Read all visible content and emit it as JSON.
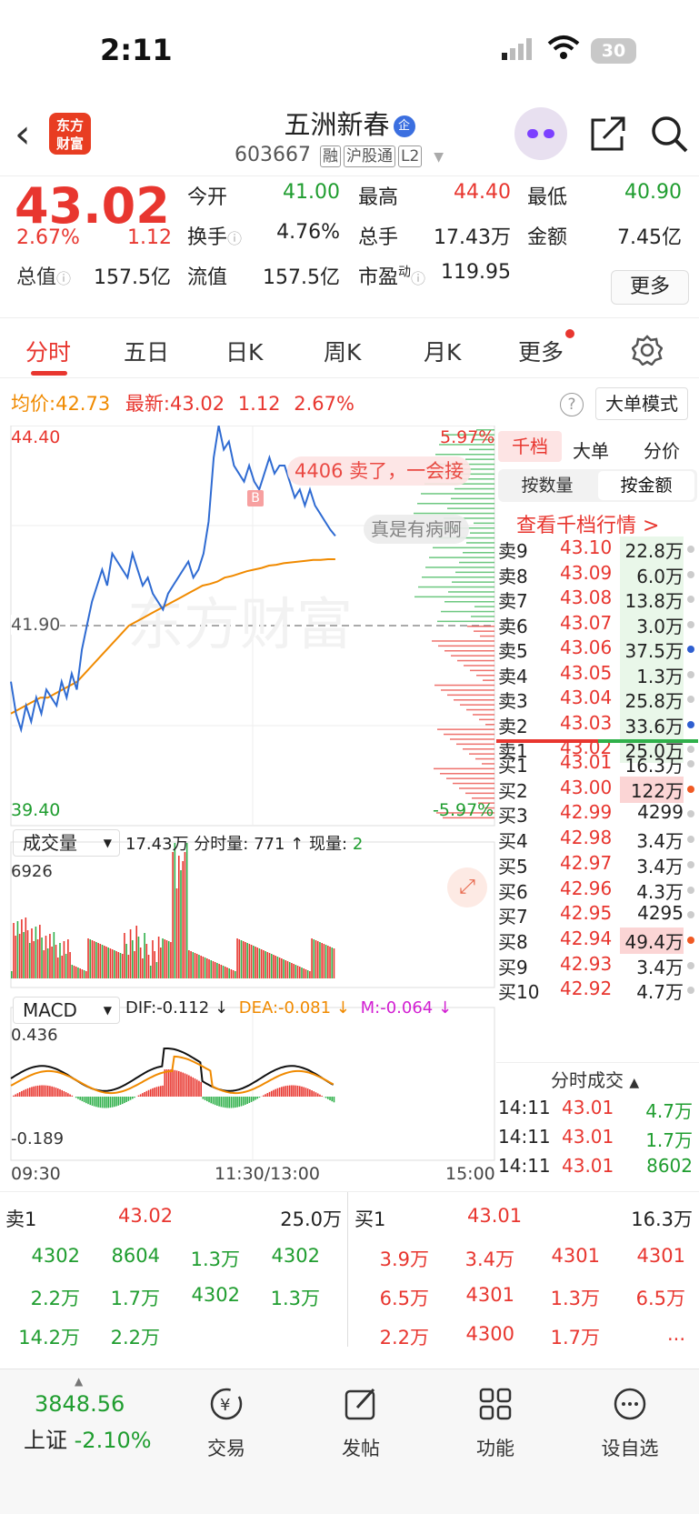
{
  "status_bar": {
    "time": "2:11",
    "battery": "30"
  },
  "header": {
    "logo_text_1": "东方",
    "logo_text_2": "财富",
    "stock_name": "五洲新春",
    "company_badge": "企",
    "code": "603667",
    "tags": [
      "融",
      "沪股通",
      "L2"
    ]
  },
  "quote": {
    "price": "43.02",
    "pct": "2.67%",
    "change": "1.12",
    "fields": [
      {
        "label": "今开",
        "value": "41.00",
        "color": "green"
      },
      {
        "label": "最高",
        "value": "44.40",
        "color": "red"
      },
      {
        "label": "最低",
        "value": "40.90",
        "color": "green"
      },
      {
        "label": "换手",
        "value": "4.76%",
        "color": "black"
      },
      {
        "label": "总手",
        "value": "17.43万",
        "color": "black"
      },
      {
        "label": "金额",
        "value": "7.45亿",
        "color": "black"
      },
      {
        "label": "总值",
        "value": "157.5亿",
        "color": "black"
      },
      {
        "label": "流值",
        "value": "157.5亿",
        "color": "black"
      },
      {
        "label": "市盈",
        "value": "119.95",
        "color": "black"
      }
    ],
    "pe_sup": "动",
    "more_label": "更多"
  },
  "tabs": [
    "分时",
    "五日",
    "日K",
    "周K",
    "月K",
    "更多"
  ],
  "avg_line": {
    "avg_label": "均价:",
    "avg": "42.73",
    "latest_label": "最新:",
    "latest": "43.02",
    "chg": "1.12",
    "pct": "2.67%"
  },
  "big_order_mode": "大单模式",
  "chart_data": {
    "type": "line",
    "price_axis": {
      "max": "44.40",
      "ref": "41.90",
      "min": "39.40",
      "max_pct": "5.97%",
      "min_pct": "-5.97%"
    },
    "time_labels": [
      "09:30",
      "11:30/13:00",
      "15:00"
    ],
    "price_series": [
      41.2,
      40.8,
      40.6,
      40.9,
      40.7,
      41.0,
      40.8,
      41.1,
      41.0,
      40.9,
      41.2,
      41.0,
      41.3,
      41.1,
      41.6,
      41.9,
      42.2,
      42.4,
      42.6,
      42.4,
      42.8,
      42.7,
      42.6,
      42.5,
      42.8,
      42.6,
      42.4,
      42.5,
      42.3,
      42.2,
      42.1,
      42.3,
      42.4,
      42.5,
      42.6,
      42.7,
      42.5,
      42.6,
      42.8,
      43.2,
      44.0,
      44.4,
      44.1,
      44.2,
      43.9,
      43.8,
      43.7,
      43.9,
      43.7,
      43.6,
      43.8,
      44.0,
      43.8,
      43.9,
      43.9,
      43.7,
      43.5,
      43.6,
      43.4,
      43.6,
      43.4,
      43.3,
      43.2,
      43.1,
      43.02
    ],
    "avg_series": [
      40.8,
      40.85,
      40.9,
      40.95,
      41.0,
      41.0,
      41.05,
      41.1,
      41.15,
      41.2,
      41.3,
      41.4,
      41.5,
      41.6,
      41.7,
      41.8,
      41.9,
      41.95,
      42.0,
      42.05,
      42.1,
      42.15,
      42.2,
      42.25,
      42.3,
      42.35,
      42.4,
      42.42,
      42.45,
      42.5,
      42.52,
      42.55,
      42.58,
      42.6,
      42.62,
      42.65,
      42.66,
      42.68,
      42.69,
      42.7,
      42.71,
      42.72,
      42.72,
      42.73,
      42.73
    ],
    "volume_header": {
      "label": "成交量",
      "total": "17.43万",
      "tick_label": "分时量:",
      "tick": "771",
      "arrow": "↑",
      "now_label": "现量:",
      "now": "2"
    },
    "volume_max": "6926",
    "macd_header": {
      "label": "MACD",
      "dif": "DIF:-0.112",
      "dea": "DEA:-0.081",
      "m": "M:-0.064"
    },
    "macd_axis": {
      "max": "0.436",
      "min": "-0.189"
    }
  },
  "annotations": {
    "comment1": "4406 卖了，一会接",
    "comment2": "真是有病啊",
    "buy_marker": "B",
    "watermark": "东方财富"
  },
  "order_book": {
    "tabs": [
      "千档",
      "大单",
      "分价"
    ],
    "subtabs": [
      "按数量",
      "按金额"
    ],
    "view_link": "查看千档行情 >",
    "asks": [
      {
        "label": "卖9",
        "price": "43.10",
        "vol": "22.8万"
      },
      {
        "label": "卖8",
        "price": "43.09",
        "vol": "6.0万"
      },
      {
        "label": "卖7",
        "price": "43.08",
        "vol": "13.8万"
      },
      {
        "label": "卖6",
        "price": "43.07",
        "vol": "3.0万"
      },
      {
        "label": "卖5",
        "price": "43.06",
        "vol": "37.5万"
      },
      {
        "label": "卖4",
        "price": "43.05",
        "vol": "1.3万"
      },
      {
        "label": "卖3",
        "price": "43.04",
        "vol": "25.8万"
      },
      {
        "label": "卖2",
        "price": "43.03",
        "vol": "33.6万"
      },
      {
        "label": "卖1",
        "price": "43.02",
        "vol": "25.0万"
      }
    ],
    "bids": [
      {
        "label": "买1",
        "price": "43.01",
        "vol": "16.3万"
      },
      {
        "label": "买2",
        "price": "43.00",
        "vol": "122万"
      },
      {
        "label": "买3",
        "price": "42.99",
        "vol": "4299"
      },
      {
        "label": "买4",
        "price": "42.98",
        "vol": "3.4万"
      },
      {
        "label": "买5",
        "price": "42.97",
        "vol": "3.4万"
      },
      {
        "label": "买6",
        "price": "42.96",
        "vol": "4.3万"
      },
      {
        "label": "买7",
        "price": "42.95",
        "vol": "4295"
      },
      {
        "label": "买8",
        "price": "42.94",
        "vol": "49.4万"
      },
      {
        "label": "买9",
        "price": "42.93",
        "vol": "3.4万"
      },
      {
        "label": "买10",
        "price": "42.92",
        "vol": "4.7万"
      }
    ],
    "ticks_title": "分时成交",
    "ticks": [
      {
        "time": "14:11",
        "price": "43.01",
        "vol": "4.7万"
      },
      {
        "time": "14:11",
        "price": "43.01",
        "vol": "1.7万"
      },
      {
        "time": "14:11",
        "price": "43.01",
        "vol": "8602"
      }
    ]
  },
  "bottom_quote": {
    "sell": {
      "label": "卖1",
      "price": "43.02",
      "vol": "25.0万",
      "rows": [
        [
          "4302",
          "8604",
          "1.3万",
          "4302"
        ],
        [
          "2.2万",
          "1.7万",
          "4302",
          "1.3万"
        ],
        [
          "14.2万",
          "2.2万",
          "",
          ""
        ]
      ]
    },
    "buy": {
      "label": "买1",
      "price": "43.01",
      "vol": "16.3万",
      "rows": [
        [
          "3.9万",
          "3.4万",
          "4301",
          "4301"
        ],
        [
          "6.5万",
          "4301",
          "1.3万",
          "6.5万"
        ],
        [
          "2.2万",
          "4300",
          "1.7万",
          "..."
        ]
      ]
    }
  },
  "navbar": {
    "index_value": "3848.56",
    "index_name": "上证",
    "index_pct": "-2.10%",
    "items": [
      "交易",
      "发帖",
      "功能",
      "设自选"
    ]
  }
}
